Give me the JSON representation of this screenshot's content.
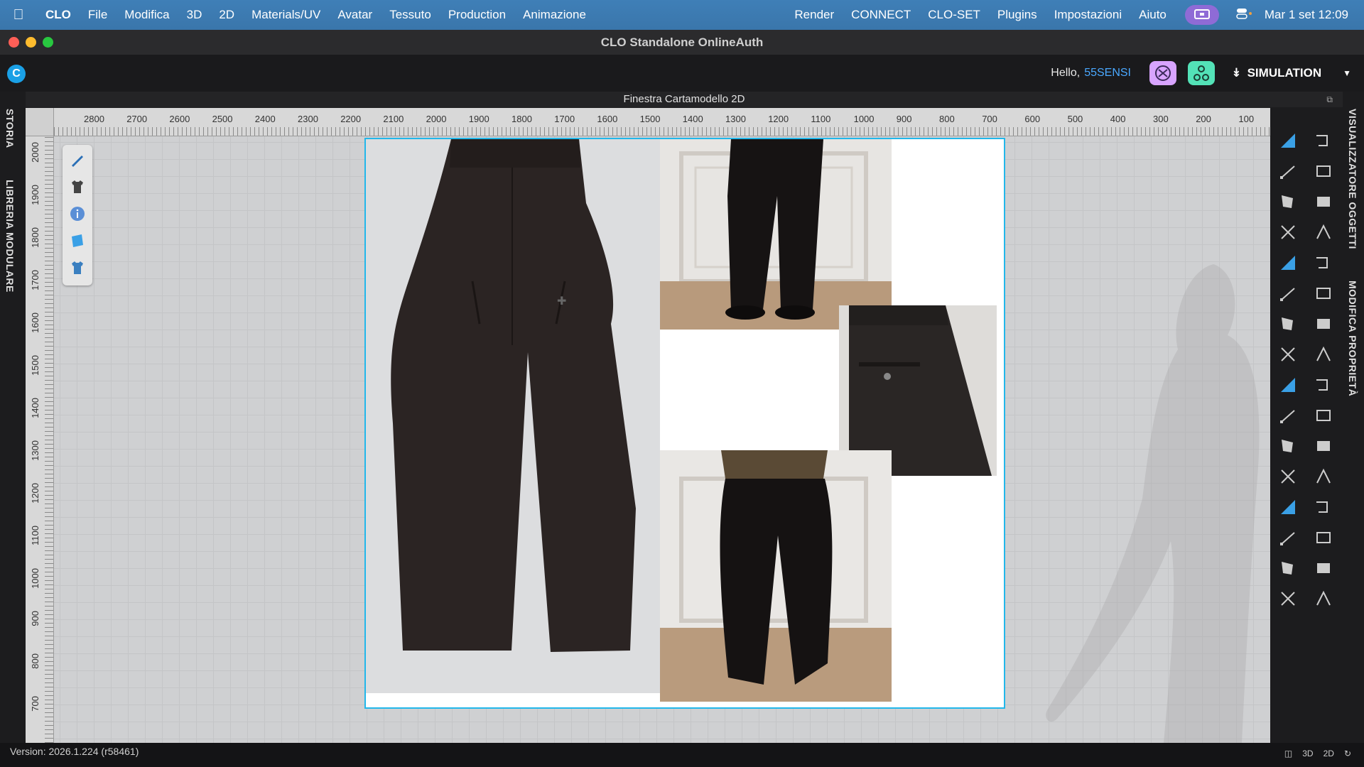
{
  "menubar": {
    "app": "CLO",
    "items": [
      "File",
      "Modifica",
      "3D",
      "2D",
      "Materials/UV",
      "Avatar",
      "Tessuto",
      "Production",
      "Animazione"
    ],
    "right_items": [
      "Render",
      "CONNECT",
      "CLO-SET",
      "Plugins",
      "Impostazioni",
      "Aiuto"
    ],
    "clock": "Mar 1 set  12:09"
  },
  "window": {
    "title": "CLO Standalone OnlineAuth"
  },
  "header": {
    "greeting": "Hello,",
    "username": "55SENSI",
    "mode": "SIMULATION",
    "accent": "#4aa8ff"
  },
  "panel": {
    "title": "Finestra Cartamodello 2D",
    "left_tabs": [
      "STORIA",
      "LIBRERIA MODULARE"
    ],
    "right_tabs": [
      "VISUALIZZATORE OGGETTI",
      "MODIFICA PROPRIETÀ"
    ]
  },
  "ruler": {
    "h_labels": [
      "2800",
      "2700",
      "2600",
      "2500",
      "2400",
      "2300",
      "2200",
      "2100",
      "2000",
      "1900",
      "1800",
      "1700",
      "1600",
      "1500",
      "1400",
      "1300",
      "1200",
      "1100",
      "1000",
      "900",
      "800",
      "700",
      "600",
      "500",
      "400",
      "300",
      "200",
      "100"
    ],
    "v_labels": [
      "2000",
      "1900",
      "1800",
      "1700",
      "1600",
      "1500",
      "1400",
      "1300",
      "1200",
      "1100",
      "1000",
      "900",
      "800",
      "700"
    ]
  },
  "tool_palette": [
    "pen-icon",
    "shirt-icon",
    "info-icon",
    "fabric-icon",
    "garment-icon"
  ],
  "toolbar_icons": [
    "edit-pattern-icon",
    "transform-icon",
    "edit-point-icon",
    "edit-segment-icon",
    "polygon-icon",
    "rectangle-icon",
    "internal-line-icon",
    "dart-icon",
    "trace-icon",
    "sewing-icon",
    "fold-icon",
    "pin-icon",
    "segment-sewing-icon",
    "free-sewing-icon",
    "notch-icon",
    "measure-icon",
    "grading-icon",
    "pleat-icon",
    "text-icon",
    "annotation-icon",
    "button-icon",
    "buttonhole-icon",
    "zipper-icon",
    "topstitch-icon",
    "puckering-icon",
    "fusing-icon",
    "trim-icon",
    "graphic-icon",
    "mesh-icon",
    "texture-icon",
    "avatar-icon",
    "fill-icon"
  ],
  "status": {
    "version": "Version: 2026.1.224 (r58461)",
    "view_modes": [
      "3D",
      "2D"
    ]
  }
}
